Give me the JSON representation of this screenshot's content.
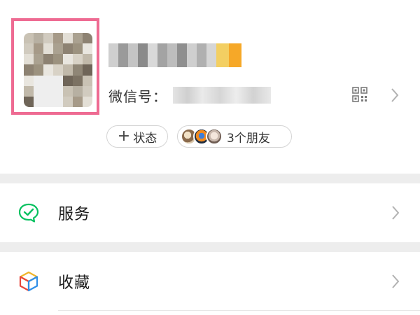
{
  "profile": {
    "wechat_id_label": "微信号：",
    "status_label": "状态",
    "status_plus": "+",
    "friends_label": "3个朋友"
  },
  "menu": [
    {
      "label": "服务",
      "icon": "service-wallet-icon"
    },
    {
      "label": "收藏",
      "icon": "favorites-cube-icon"
    }
  ],
  "colors": {
    "highlight": "#ee6b92",
    "service_green": "#07c160",
    "divider": "#ededed"
  }
}
